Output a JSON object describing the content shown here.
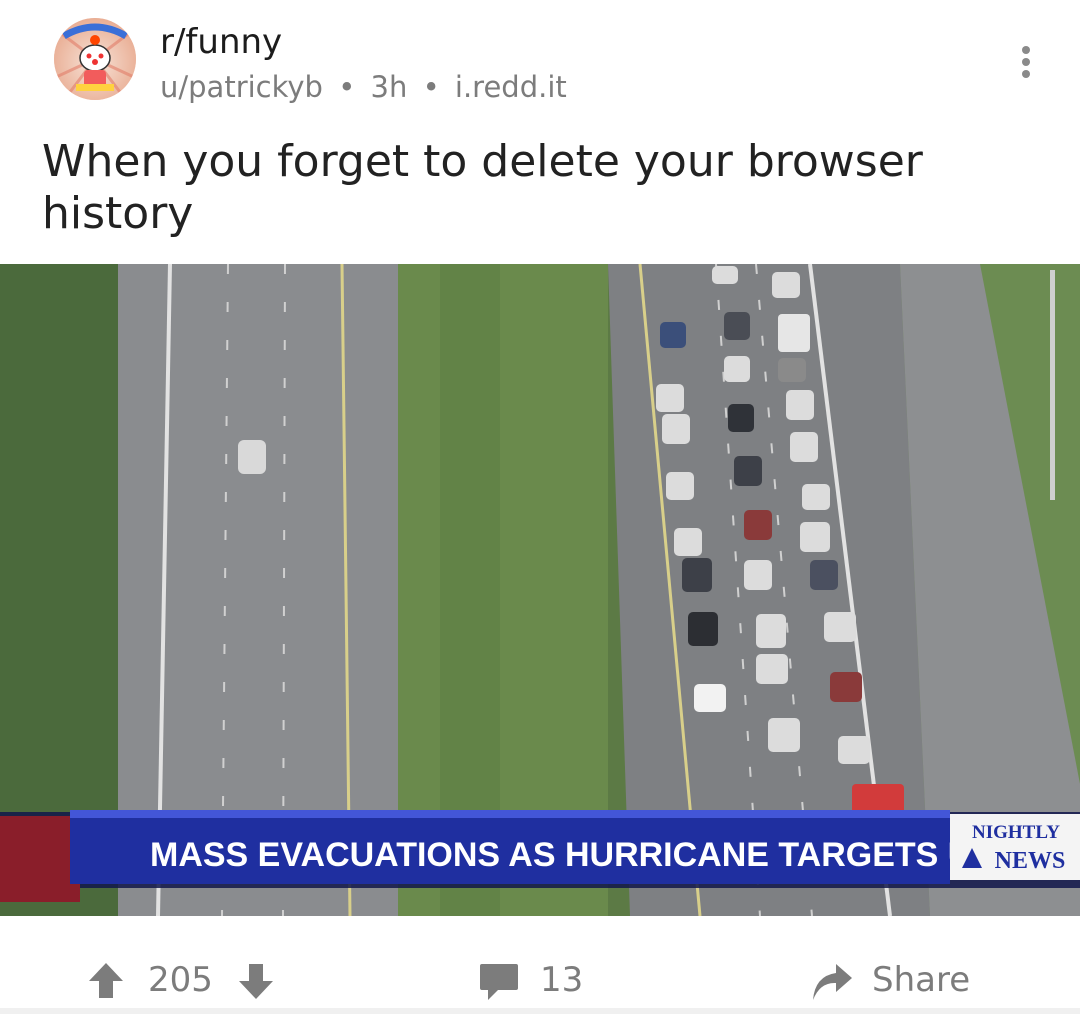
{
  "post": {
    "subreddit": "r/funny",
    "author": "u/patrickyb",
    "age": "3h",
    "domain": "i.redd.it",
    "separator": "•",
    "title": "When you forget to delete your browser history"
  },
  "image": {
    "banner_text": "MASS EVACUATIONS AS HURRICANE TARGETS U.S.",
    "logo_line1": "NIGHTLY",
    "logo_line2": "NEWS"
  },
  "actions": {
    "upvotes": "205",
    "comments": "13",
    "share_label": "Share"
  },
  "icons": {
    "more": "more-vertical-icon",
    "upvote": "arrow-up-icon",
    "downvote": "arrow-down-icon",
    "comment": "comment-bubble-icon",
    "share": "share-arrow-icon"
  },
  "colors": {
    "meta_text": "#7c7c7c",
    "banner_blue": "#1f2fa0"
  }
}
